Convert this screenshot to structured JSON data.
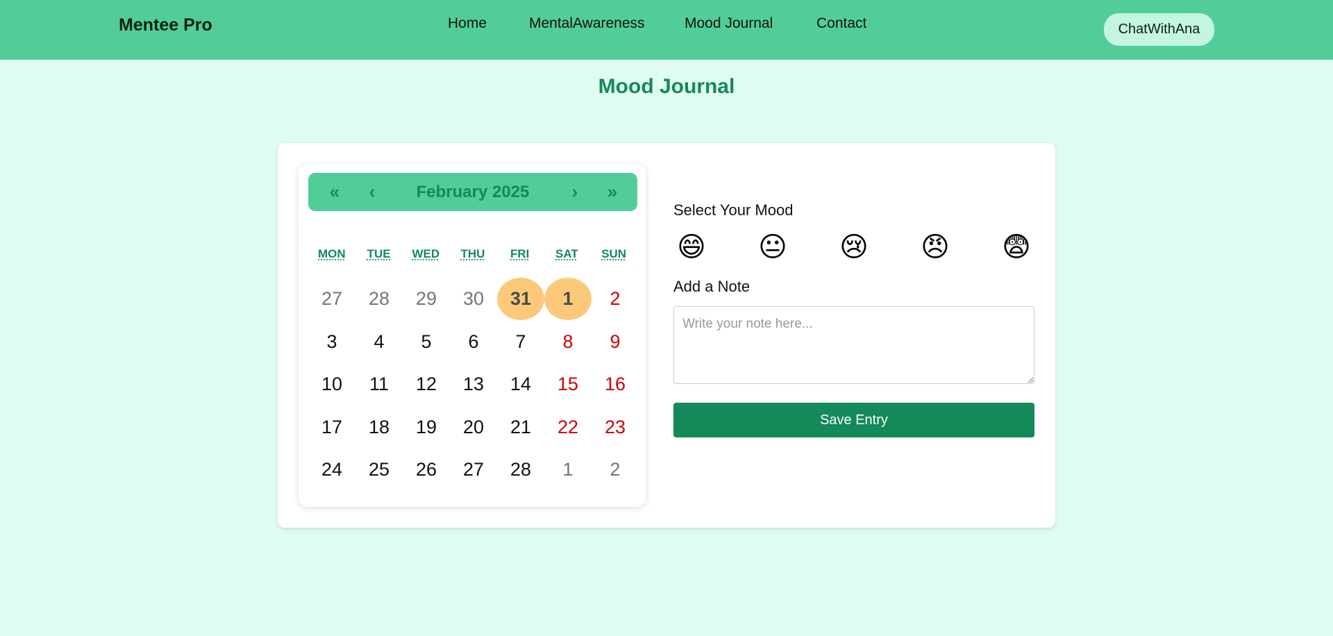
{
  "navbar": {
    "brand": "Mentee Pro",
    "links": [
      {
        "label": "Home"
      },
      {
        "label": "MentalAwareness"
      },
      {
        "label": "Mood Journal"
      },
      {
        "label": "Contact"
      }
    ],
    "chat_button": "ChatWithAna"
  },
  "page_title": "Mood Journal",
  "calendar": {
    "nav_prev_year": "«",
    "nav_prev_month": "‹",
    "month_label": "February 2025",
    "nav_next_month": "›",
    "nav_next_year": "»",
    "weekdays": [
      "MON",
      "TUE",
      "WED",
      "THU",
      "FRI",
      "SAT",
      "SUN"
    ],
    "days": [
      {
        "label": "27",
        "type": "other"
      },
      {
        "label": "28",
        "type": "other"
      },
      {
        "label": "29",
        "type": "other"
      },
      {
        "label": "30",
        "type": "other"
      },
      {
        "label": "31",
        "type": "selected"
      },
      {
        "label": "1",
        "type": "selected"
      },
      {
        "label": "2",
        "type": "weekend"
      },
      {
        "label": "3",
        "type": "normal"
      },
      {
        "label": "4",
        "type": "normal"
      },
      {
        "label": "5",
        "type": "normal"
      },
      {
        "label": "6",
        "type": "normal"
      },
      {
        "label": "7",
        "type": "normal"
      },
      {
        "label": "8",
        "type": "weekend"
      },
      {
        "label": "9",
        "type": "weekend"
      },
      {
        "label": "10",
        "type": "normal"
      },
      {
        "label": "11",
        "type": "normal"
      },
      {
        "label": "12",
        "type": "normal"
      },
      {
        "label": "13",
        "type": "normal"
      },
      {
        "label": "14",
        "type": "normal"
      },
      {
        "label": "15",
        "type": "weekend"
      },
      {
        "label": "16",
        "type": "weekend"
      },
      {
        "label": "17",
        "type": "normal"
      },
      {
        "label": "18",
        "type": "normal"
      },
      {
        "label": "19",
        "type": "normal"
      },
      {
        "label": "20",
        "type": "normal"
      },
      {
        "label": "21",
        "type": "normal"
      },
      {
        "label": "22",
        "type": "weekend"
      },
      {
        "label": "23",
        "type": "weekend"
      },
      {
        "label": "24",
        "type": "normal"
      },
      {
        "label": "25",
        "type": "normal"
      },
      {
        "label": "26",
        "type": "normal"
      },
      {
        "label": "27",
        "type": "normal"
      },
      {
        "label": "28",
        "type": "normal"
      },
      {
        "label": "1",
        "type": "other"
      },
      {
        "label": "2",
        "type": "other"
      }
    ]
  },
  "mood": {
    "label": "Select Your Mood",
    "options": [
      {
        "emoji": "😄",
        "icon": "grinning-face-icon"
      },
      {
        "emoji": "😐",
        "icon": "neutral-face-icon"
      },
      {
        "emoji": "😢",
        "icon": "crying-face-icon"
      },
      {
        "emoji": "😠",
        "icon": "angry-face-icon"
      },
      {
        "emoji": "😨",
        "icon": "fearful-face-icon"
      }
    ]
  },
  "note": {
    "label": "Add a Note",
    "value": "",
    "placeholder": "Write your note here..."
  },
  "save_button": "Save Entry",
  "colors": {
    "navbar": "#52cd99",
    "background": "#dffcf0",
    "accent": "#14895a",
    "selected_day": "#fcc97a",
    "weekend": "#d10000"
  }
}
